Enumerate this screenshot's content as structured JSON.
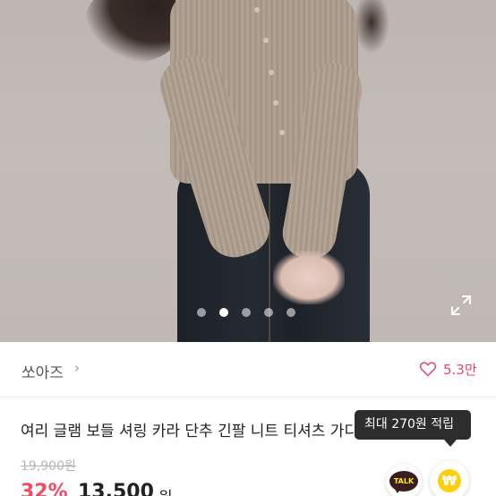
{
  "gallery": {
    "dot_count": 5,
    "active_dot": 2,
    "expand_icon": "expand-icon"
  },
  "shop": {
    "name": "쏘아즈",
    "chevron": "›",
    "likes": "5.3만",
    "heart_icon": "heart-outline-icon",
    "like_color": "#e8466b"
  },
  "product": {
    "title": "여리 글램 보들 셔링 카라 단추 긴팔 니트 티셔츠 가디건",
    "original_price": "19,900원",
    "discount": "32%",
    "price": "13,500",
    "price_unit": "원"
  },
  "reward_tooltip": {
    "text": "최대 270원 적립"
  },
  "floating": {
    "talk_label": "TALK",
    "coin_symbol": "₩"
  },
  "colors": {
    "discount": "#f04a64",
    "tooltip_bg": "#2d2d2d",
    "coin": "#ffcf0d",
    "talk_bubble": "#3a1d1d"
  }
}
